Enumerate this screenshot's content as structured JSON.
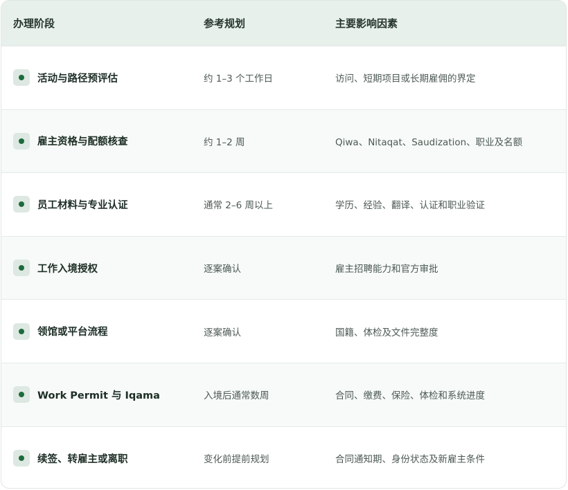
{
  "table": {
    "headers": {
      "stage": "办理阶段",
      "plan": "参考规划",
      "factors": "主要影响因素"
    },
    "rows": [
      {
        "stage": "活动与路径预评估",
        "plan": "约 1–3 个工作日",
        "factors": "访问、短期项目或长期雇佣的界定"
      },
      {
        "stage": "雇主资格与配额核查",
        "plan": "约 1–2 周",
        "factors": "Qiwa、Nitaqat、Saudization、职业及名额"
      },
      {
        "stage": "员工材料与专业认证",
        "plan": "通常 2–6 周以上",
        "factors": "学历、经验、翻译、认证和职业验证"
      },
      {
        "stage": "工作入境授权",
        "plan": "逐案确认",
        "factors": "雇主招聘能力和官方审批"
      },
      {
        "stage": "领馆或平台流程",
        "plan": "逐案确认",
        "factors": "国籍、体检及文件完整度"
      },
      {
        "stage": "Work Permit 与 Iqama",
        "plan": "入境后通常数周",
        "factors": "合同、缴费、保险、体检和系统进度"
      },
      {
        "stage": "续签、转雇主或离职",
        "plan": "变化前提前规划",
        "factors": "合同通知期、身份状态及新雇主条件"
      }
    ]
  },
  "colors": {
    "header_bg": "#e8f0eb",
    "alt_row_bg": "#f7faf8",
    "bullet_bg": "#dde8e2",
    "bullet_dot": "#1d6a3c"
  }
}
